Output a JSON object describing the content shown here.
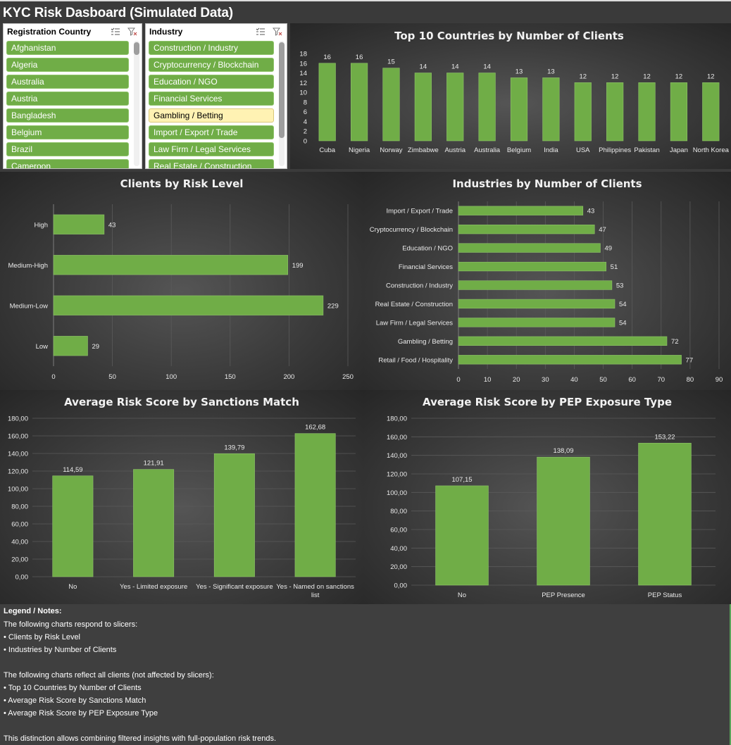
{
  "title": "KYC Risk Dasboard (Simulated Data)",
  "slicers": [
    {
      "title": "Registration Country",
      "items": [
        "Afghanistan",
        "Algeria",
        "Australia",
        "Austria",
        "Bangladesh",
        "Belgium",
        "Brazil",
        "Cameroon"
      ],
      "selected_index": -1,
      "icons": [
        "multi-select-icon",
        "clear-filter-icon"
      ]
    },
    {
      "title": "Industry",
      "items": [
        "Construction / Industry",
        "Cryptocurrency / Blockchain",
        "Education / NGO",
        "Financial Services",
        "Gambling / Betting",
        "Import / Export / Trade",
        "Law Firm / Legal Services",
        "Real Estate / Construction"
      ],
      "selected_index": 4,
      "icons": [
        "multi-select-icon",
        "clear-filter-icon"
      ]
    }
  ],
  "chart_data": [
    {
      "id": "top10",
      "type": "bar",
      "title": "Top 10 Countries by Number of Clients",
      "categories": [
        "Cuba",
        "Nigeria",
        "Norway",
        "Zimbabwe",
        "Austria",
        "Australia",
        "Belgium",
        "India",
        "USA",
        "Philippines",
        "Pakistan",
        "Japan",
        "North Korea"
      ],
      "values": [
        16,
        16,
        15,
        14,
        14,
        14,
        13,
        13,
        12,
        12,
        12,
        12,
        12
      ],
      "ylim": [
        0,
        18
      ],
      "yticks": [
        "0",
        "2",
        "4",
        "6",
        "8",
        "10",
        "12",
        "14",
        "16",
        "18"
      ],
      "grid": false
    },
    {
      "id": "risk",
      "type": "bar",
      "orientation": "horizontal",
      "title": "Clients by Risk Level",
      "categories": [
        "High",
        "Medium-High",
        "Medium-Low",
        "Low"
      ],
      "values": [
        43,
        199,
        229,
        29
      ],
      "xlim": [
        0,
        250
      ],
      "xticks": [
        "0",
        "50",
        "100",
        "150",
        "200",
        "250"
      ],
      "grid": true
    },
    {
      "id": "industries",
      "type": "bar",
      "orientation": "horizontal",
      "title": "Industries by Number of Clients",
      "categories": [
        "Import / Export / Trade",
        "Cryptocurrency / Blockchain",
        "Education / NGO",
        "Financial Services",
        "Construction / Industry",
        "Real Estate / Construction",
        "Law Firm / Legal Services",
        "Gambling / Betting",
        "Retail / Food / Hospitality"
      ],
      "values": [
        43,
        47,
        49,
        51,
        53,
        54,
        54,
        72,
        77
      ],
      "xlim": [
        0,
        90
      ],
      "xticks": [
        "0",
        "10",
        "20",
        "30",
        "40",
        "50",
        "60",
        "70",
        "80",
        "90"
      ],
      "grid": true
    },
    {
      "id": "sanctions",
      "type": "bar",
      "title": "Average Risk Score by Sanctions Match",
      "categories": [
        "No",
        "Yes - Limited exposure",
        "Yes - Significant exposure",
        "Yes - Named on sanctions list"
      ],
      "values": [
        114.59,
        121.91,
        139.79,
        162.68
      ],
      "value_labels": [
        "114,59",
        "121,91",
        "139,79",
        "162,68"
      ],
      "ylim": [
        0,
        180
      ],
      "yticks": [
        "0,00",
        "20,00",
        "40,00",
        "60,00",
        "80,00",
        "100,00",
        "120,00",
        "140,00",
        "160,00",
        "180,00"
      ],
      "grid": true
    },
    {
      "id": "pep",
      "type": "bar",
      "title": "Average Risk Score by PEP Exposure Type",
      "categories": [
        "No",
        "PEP Presence",
        "PEP Status"
      ],
      "values": [
        107.15,
        138.09,
        153.22
      ],
      "value_labels": [
        "107,15",
        "138,09",
        "153,22"
      ],
      "ylim": [
        0,
        180
      ],
      "yticks": [
        "0,00",
        "20,00",
        "40,00",
        "60,00",
        "80,00",
        "100,00",
        "120,00",
        "140,00",
        "160,00",
        "180,00"
      ],
      "grid": true
    }
  ],
  "colors": {
    "bar": "#70ad47",
    "bar_edge": "#8fc46a",
    "gridline": "#5a5a5a"
  },
  "notes": {
    "title": "Legend / Notes:",
    "lines": [
      "The following charts respond to slicers:",
      "• Clients by Risk Level",
      "• Industries by Number of Clients",
      "",
      "The following charts reflect all clients (not affected by slicers):",
      "• Top 10 Countries by Number of Clients",
      "• Average Risk Score by Sanctions Match",
      "• Average Risk Score by PEP Exposure Type",
      "",
      "This distinction allows combining filtered insights with full-population risk trends."
    ]
  }
}
